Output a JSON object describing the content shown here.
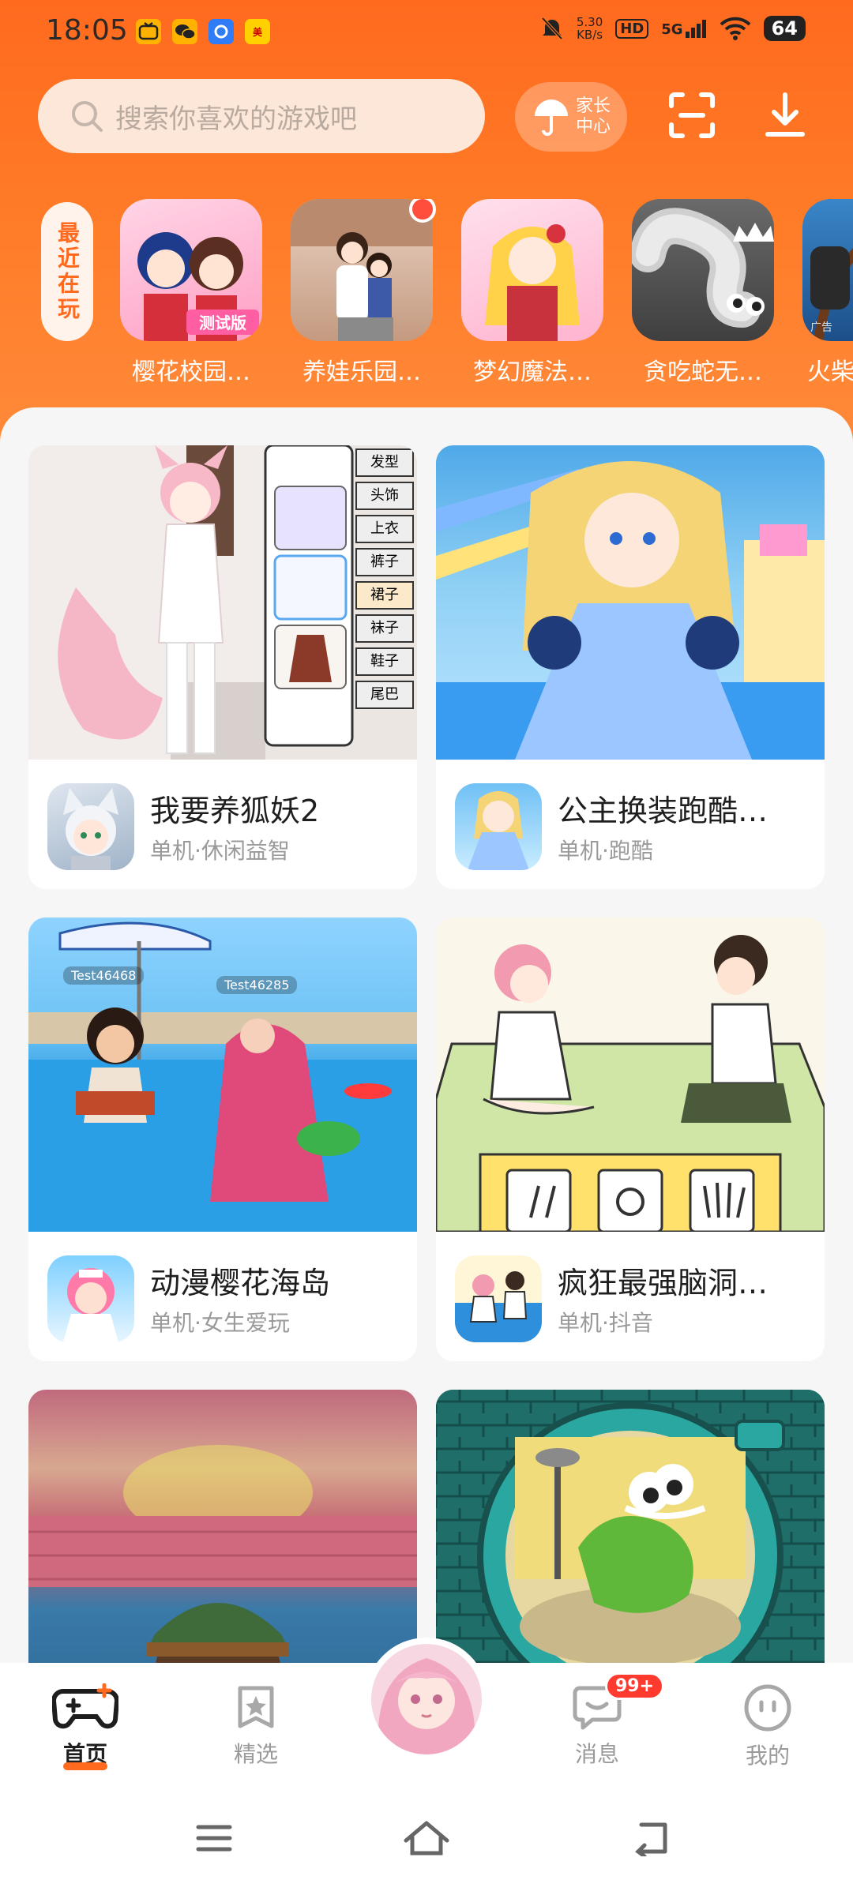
{
  "status_bar": {
    "time": "18:05",
    "net_speed_value": "5.30",
    "net_speed_unit": "KB/s",
    "hd": "HD",
    "signal": "5G",
    "battery": "64"
  },
  "header": {
    "search_placeholder": "搜索你喜欢的游戏吧",
    "parent_center_line1": "家长",
    "parent_center_line2": "中心",
    "accent_color": "#ff6a1f"
  },
  "recent": {
    "tag": "最近在玩",
    "items": [
      {
        "name": "樱花校园…",
        "icon": "anime-school-girls-thumb",
        "badge_text": "测试版"
      },
      {
        "name": "养娃乐园…",
        "icon": "family-thumb",
        "has_dot": true
      },
      {
        "name": "梦幻魔法…",
        "icon": "magic-girl-thumb"
      },
      {
        "name": "贪吃蛇无…",
        "icon": "snake-thumb"
      },
      {
        "name": "火柴",
        "icon": "stick-thumb",
        "ad_label": "广告"
      }
    ]
  },
  "cards": [
    {
      "title": "我要养狐妖2",
      "tags": "单机·休闲益智",
      "side_menu": [
        "发型",
        "头饰",
        "上衣",
        "裤子",
        "裙子",
        "袜子",
        "鞋子",
        "尾巴"
      ]
    },
    {
      "title": "公主换装跑酷…",
      "tags": "单机·跑酷"
    },
    {
      "title": "动漫樱花海岛",
      "tags": "单机·女生爱玩",
      "name_tags": [
        "Test46468",
        "Test46285"
      ]
    },
    {
      "title": "疯狂最强脑洞…",
      "tags": "单机·抖音"
    },
    {
      "title": "",
      "tags": ""
    },
    {
      "title": "",
      "tags": ""
    }
  ],
  "bottom_nav": {
    "items": [
      {
        "label": "首页",
        "icon": "gamepad-icon",
        "active": true
      },
      {
        "label": "精选",
        "icon": "star-bookmark-icon"
      },
      {
        "label": "消息",
        "icon": "chat-icon",
        "badge": "99+"
      },
      {
        "label": "我的",
        "icon": "smile-icon"
      }
    ]
  }
}
